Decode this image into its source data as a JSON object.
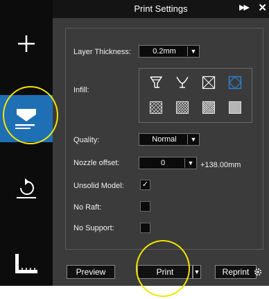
{
  "header": {
    "title": "Print Settings"
  },
  "sidebar": {
    "items": [
      {
        "name": "add-icon"
      },
      {
        "name": "print-settings-icon"
      },
      {
        "name": "rotate-icon"
      },
      {
        "name": "ruler-icon"
      }
    ]
  },
  "settings": {
    "layer_thickness": {
      "label": "Layer Thickness:",
      "value": "0.2mm"
    },
    "infill": {
      "label": "Infill:"
    },
    "quality": {
      "label": "Quality:",
      "value": "Normal"
    },
    "nozzle_offset": {
      "label": "Nozzle offset:",
      "value": "0",
      "extra": "+138.00mm"
    },
    "unsolid_model": {
      "label": "Unsolid Model:",
      "checked": true,
      "mark": "✓"
    },
    "no_raft": {
      "label": "No Raft:",
      "checked": false
    },
    "no_support": {
      "label": "No Support:",
      "checked": false
    }
  },
  "footer": {
    "preview": "Preview",
    "print": "Print",
    "reprint": "Reprint"
  },
  "colors": {
    "active_blue": "#1f6fb5",
    "highlight": "#f3e600",
    "panel": "#3b3b3b"
  }
}
